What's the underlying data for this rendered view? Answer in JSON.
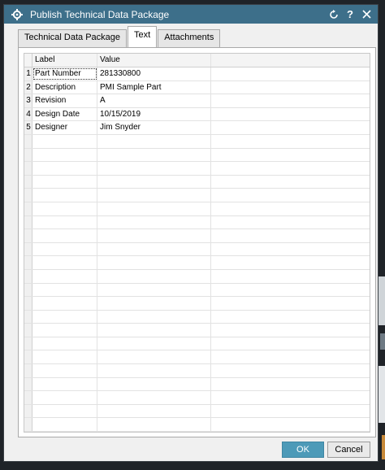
{
  "window": {
    "title": "Publish Technical Data Package"
  },
  "titlebar": {
    "reset_icon": "refresh-icon",
    "help_label": "?",
    "close_icon": "close-icon"
  },
  "tabs": [
    {
      "label": "Technical Data Package",
      "active": false
    },
    {
      "label": "Text",
      "active": true
    },
    {
      "label": "Attachments",
      "active": false
    }
  ],
  "table": {
    "columns": [
      "Label",
      "Value"
    ],
    "rows": [
      {
        "index": "1",
        "label": "Part Number",
        "value": "281330800"
      },
      {
        "index": "2",
        "label": "Description",
        "value": "PMI Sample Part"
      },
      {
        "index": "3",
        "label": "Revision",
        "value": "A"
      },
      {
        "index": "4",
        "label": "Design Date",
        "value": "10/15/2019"
      },
      {
        "index": "5",
        "label": "Designer",
        "value": "Jim Snyder"
      }
    ]
  },
  "buttons": {
    "ok_label": "OK",
    "cancel_label": "Cancel"
  },
  "colors": {
    "titlebar": "#3d6f8a",
    "ok_button": "#4d9ab8"
  }
}
